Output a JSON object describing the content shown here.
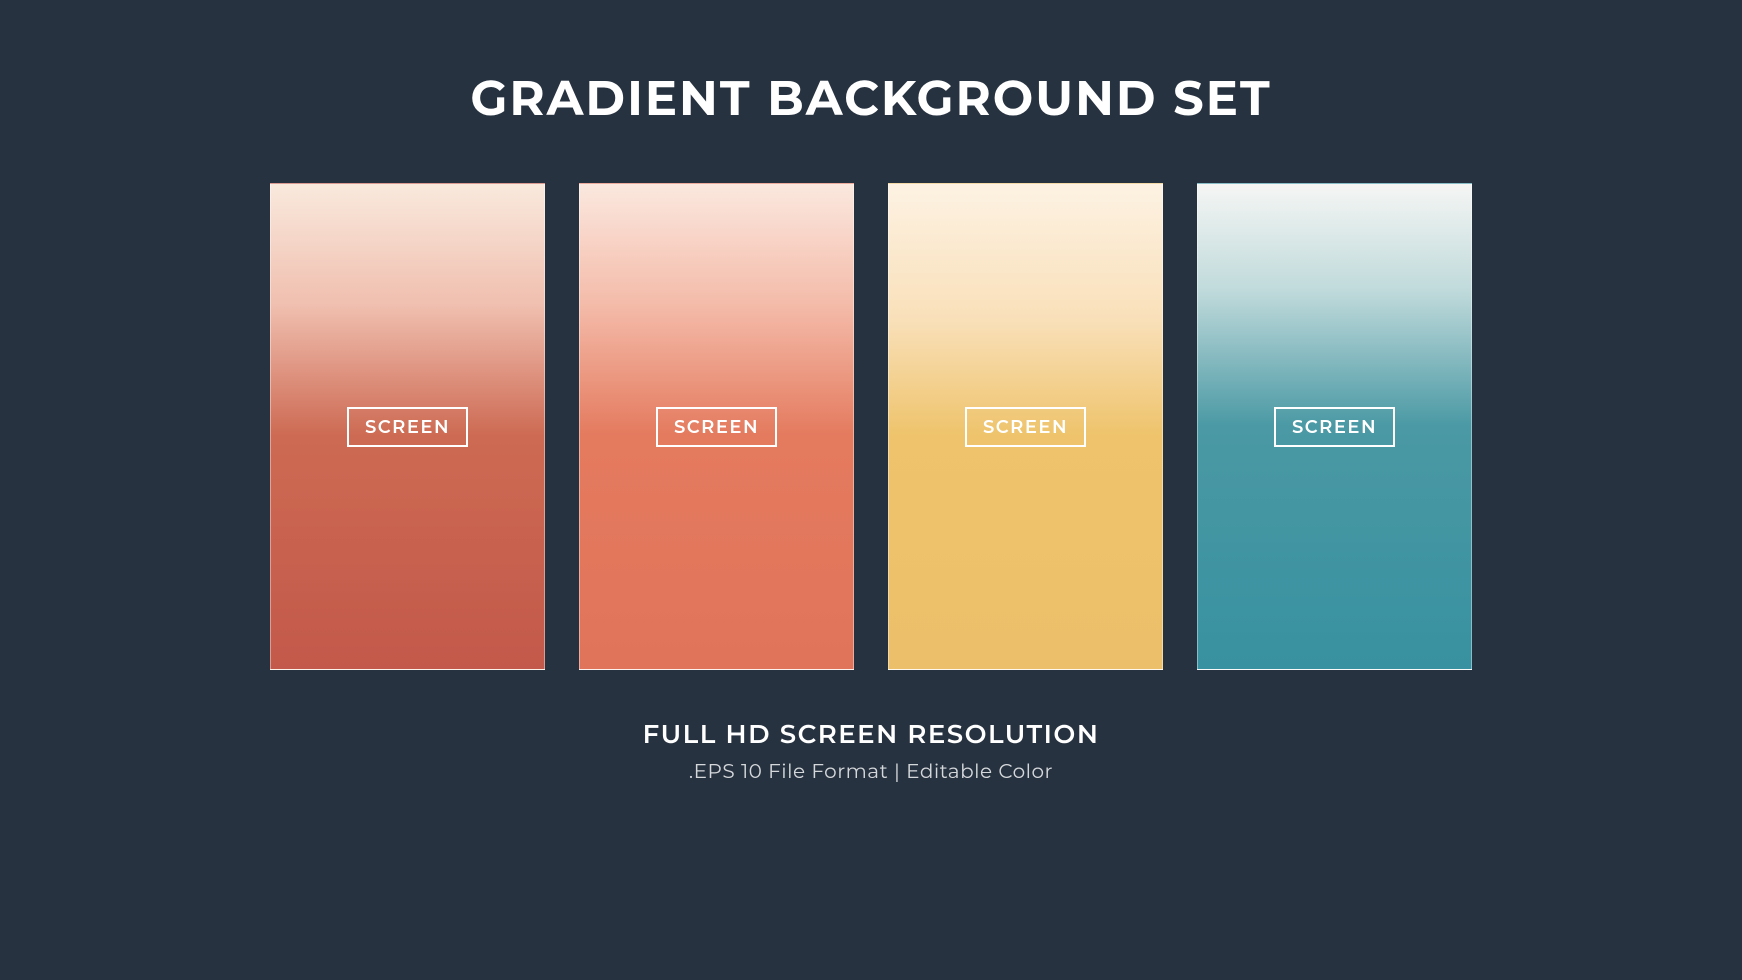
{
  "title": "GRADIENT BACKGROUND SET",
  "cards": [
    {
      "label": "SCREEN",
      "gradient": {
        "top": "#f9e9dd",
        "bottom": "#c3594a"
      }
    },
    {
      "label": "SCREEN",
      "gradient": {
        "top": "#fbe8df",
        "bottom": "#e0745b"
      }
    },
    {
      "label": "SCREEN",
      "gradient": {
        "top": "#fdf2e3",
        "bottom": "#ecc06a"
      }
    },
    {
      "label": "SCREEN",
      "gradient": {
        "top": "#f5f6f4",
        "bottom": "#3891a0"
      }
    }
  ],
  "subtitle": "FULL HD SCREEN RESOLUTION",
  "description": ".EPS 10 File Format  |  Editable Color"
}
